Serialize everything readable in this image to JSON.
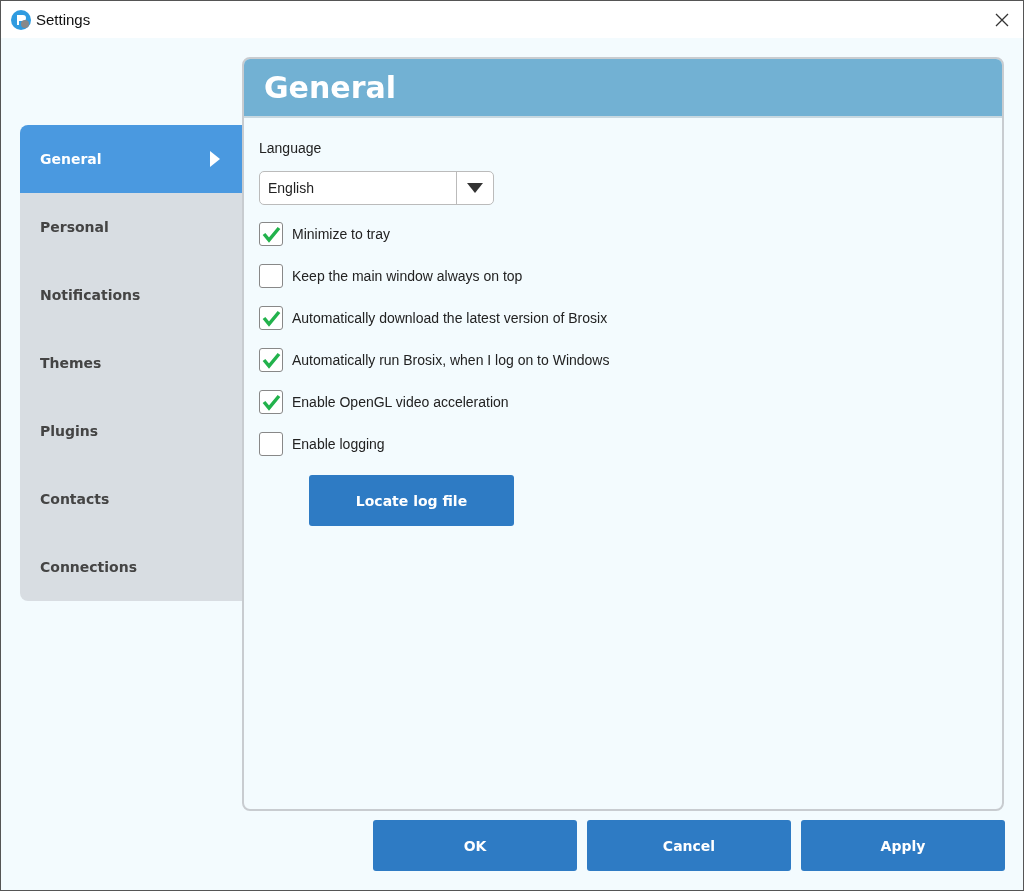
{
  "window": {
    "title": "Settings"
  },
  "sidebar": {
    "items": [
      {
        "label": "General",
        "selected": true
      },
      {
        "label": "Personal",
        "selected": false
      },
      {
        "label": "Notifications",
        "selected": false
      },
      {
        "label": "Themes",
        "selected": false
      },
      {
        "label": "Plugins",
        "selected": false
      },
      {
        "label": "Contacts",
        "selected": false
      },
      {
        "label": "Connections",
        "selected": false
      }
    ]
  },
  "panel": {
    "title": "General",
    "language_label": "Language",
    "language": {
      "value": "English"
    },
    "options": [
      {
        "label": "Minimize to tray",
        "checked": true
      },
      {
        "label": "Keep the main window always on top",
        "checked": false
      },
      {
        "label": "Automatically download the latest version of Brosix",
        "checked": true
      },
      {
        "label": "Automatically run Brosix, when I log on to Windows",
        "checked": true
      },
      {
        "label": "Enable OpenGL video acceleration",
        "checked": true
      },
      {
        "label": "Enable logging",
        "checked": false
      }
    ],
    "locate_button": "Locate log file"
  },
  "buttons": [
    "OK",
    "Cancel",
    "Apply"
  ]
}
